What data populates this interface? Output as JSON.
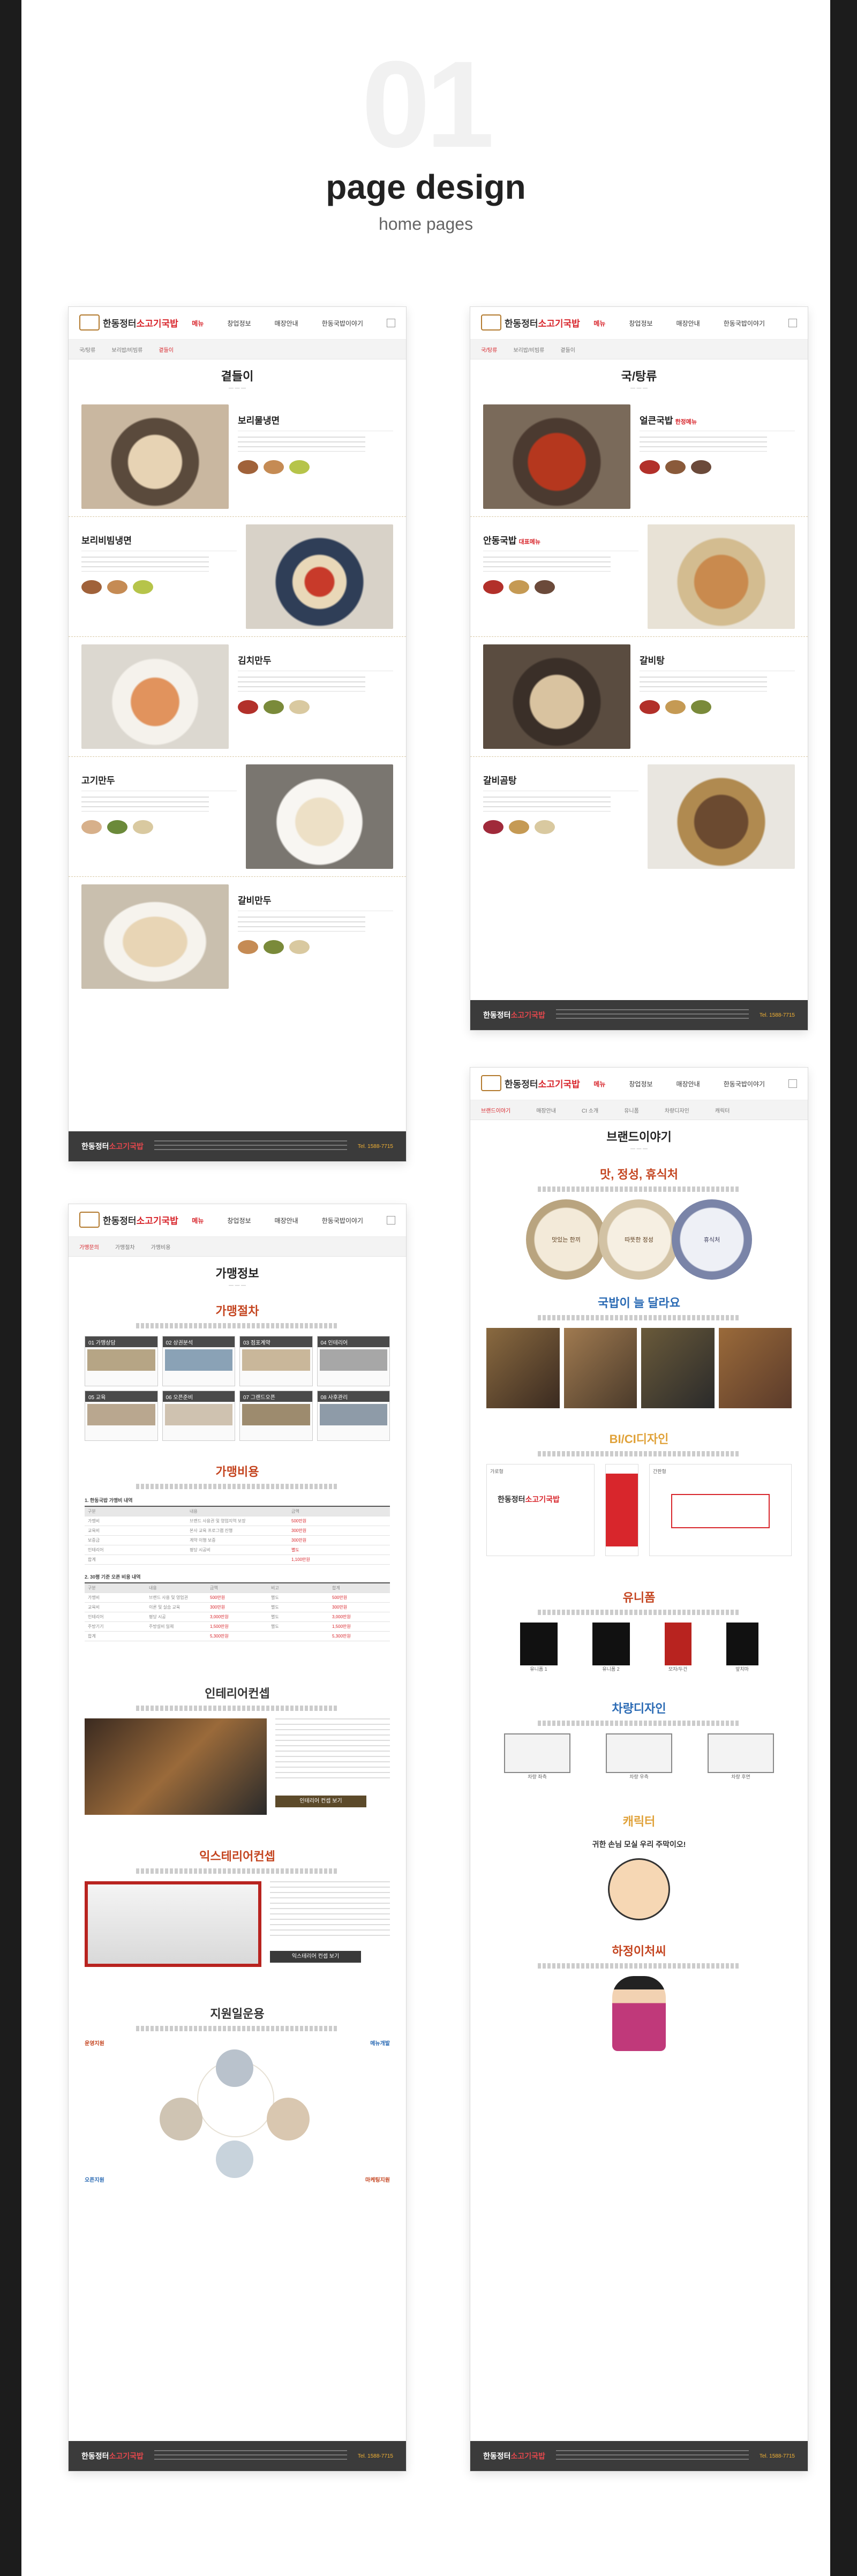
{
  "hero": {
    "number": "01",
    "title": "page design",
    "subtitle": "home pages"
  },
  "brand": {
    "logo_main": "한동정터",
    "logo_accent": "소고기국밥",
    "tel": "Tel. 1588-7715",
    "colors": {
      "accent": "#d8262c",
      "gold": "#b37a2e",
      "footer": "#3b3b3b"
    }
  },
  "gnb": {
    "menu": [
      "메뉴",
      "창업정보",
      "매장안내",
      "한동국밥이야기"
    ]
  },
  "page1": {
    "title": "곁들이",
    "tabs": [
      "국/탕류",
      "보리밥/비빔류",
      "곁들이"
    ],
    "items": [
      {
        "name": "보리물냉면"
      },
      {
        "name": "보리비빔냉면"
      },
      {
        "name": "김치만두"
      },
      {
        "name": "고기만두"
      },
      {
        "name": "갈비만두"
      }
    ]
  },
  "page2": {
    "title": "국/탕류",
    "tabs": [
      "국/탕류",
      "보리밥/비빔류",
      "곁들이"
    ],
    "items": [
      {
        "name": "얼큰국밥",
        "badge": "한정메뉴"
      },
      {
        "name": "안동국밥",
        "badge": "대표메뉴"
      },
      {
        "name": "갈비탕",
        "badge": ""
      },
      {
        "name": "갈비곰탕",
        "badge": ""
      }
    ]
  },
  "page3": {
    "title": "가맹정보",
    "tabs": [
      "가맹문의",
      "가맹절차",
      "가맹비용"
    ],
    "sections": {
      "procedure": "가맹절차",
      "cost": "가맹비용",
      "interior": "인테리어컨셉",
      "exterior": "익스테리어컨셉",
      "support": "지원일운용"
    },
    "steps": [
      "01 가맹상담",
      "02 상권분석",
      "03 점포계약",
      "04 인테리어",
      "05 교육",
      "06 오픈준비",
      "07 그랜드오픈",
      "08 사후관리"
    ],
    "table1": {
      "caption": "1. 한동국밥 가맹비 내역",
      "header": [
        "구분",
        "내용",
        "금액"
      ],
      "rows": [
        [
          "가맹비",
          "브랜드 사용권 및 영업지역 보장",
          "500만원"
        ],
        [
          "교육비",
          "본사 교육 프로그램 진행",
          "300만원"
        ],
        [
          "보증금",
          "계약 이행 보증",
          "300만원"
        ],
        [
          "인테리어",
          "평당 시공비",
          "별도"
        ],
        [
          "합계",
          "",
          "1,100만원"
        ]
      ]
    },
    "table2": {
      "caption": "2. 30평 기준 오픈 비용 내역",
      "header": [
        "구분",
        "내용",
        "금액",
        "비고",
        "합계"
      ],
      "rows": [
        [
          "가맹비",
          "브랜드 사용 및 영업권",
          "500만원",
          "별도",
          "500만원"
        ],
        [
          "교육비",
          "이론 및 실습 교육",
          "300만원",
          "별도",
          "300만원"
        ],
        [
          "인테리어",
          "평당 시공",
          "3,000만원",
          "별도",
          "3,000만원"
        ],
        [
          "주방기기",
          "주방설비 일체",
          "1,500만원",
          "별도",
          "1,500만원"
        ],
        [
          "합계",
          "",
          "5,300만원",
          "",
          "5,300만원"
        ]
      ]
    },
    "buttons": {
      "interior": "인테리어 컨셉 보기",
      "exterior": "익스테리어 컨셉 보기"
    },
    "support": [
      "운영지원",
      "메뉴개발",
      "오픈지원",
      "마케팅지원"
    ]
  },
  "page4": {
    "title": "브랜드이야기",
    "tabs": [
      "브랜드이야기",
      "매장안내",
      "CI 소개",
      "유니폼",
      "차량디자인",
      "캐릭터"
    ],
    "sections": {
      "values": "맛, 정성, 휴식처",
      "difference": "국밥이 늘 달라요",
      "bici": "BI/CI디자인",
      "uniform": "유니폼",
      "vehicle": "차량디자인",
      "character": "캐릭터",
      "mascot": "하정이처씨"
    },
    "circles": [
      "맛있는 한끼",
      "따뜻한 정성",
      "휴식처"
    ],
    "bici_labels": [
      "Symbol",
      "Logotype",
      "세로형",
      "가로형",
      "간판형"
    ],
    "colors_legend": [
      "Symbol",
      "Logotype",
      "Tone"
    ],
    "uniform_labels": [
      "유니폼 1",
      "유니폼 2",
      "모자/두건",
      "앞치마"
    ],
    "vehicle_labels": [
      "차량 좌측",
      "차량 우측",
      "차량 후면",
      "차량 전면"
    ],
    "character_banner": "귀한 손님 모실 우리 주막이오!"
  }
}
